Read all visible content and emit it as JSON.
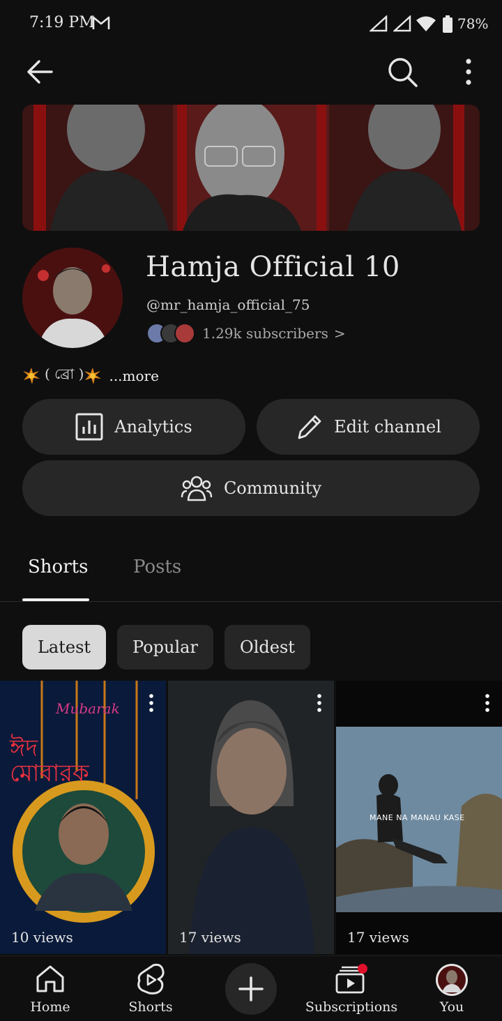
{
  "status_bar": {
    "time": "7:19 PM",
    "battery": "78%"
  },
  "channel": {
    "name": "Hamja Official 10",
    "handle": "@mr_hamja_official_75",
    "subscribers": "1.29k subscribers",
    "subscribers_chevron": ">",
    "description": "( ব্রো )",
    "description_more": "...more"
  },
  "actions": {
    "analytics": "Analytics",
    "edit_channel": "Edit channel",
    "community": "Community"
  },
  "tabs": [
    {
      "label": "Shorts",
      "selected": true
    },
    {
      "label": "Posts",
      "selected": false
    }
  ],
  "chips": [
    {
      "label": "Latest",
      "selected": true
    },
    {
      "label": "Popular",
      "selected": false
    },
    {
      "label": "Oldest",
      "selected": false
    }
  ],
  "shorts": [
    {
      "views": "10 views",
      "overlay_text": "ঈদ মোবারক",
      "overlay_text_2": "Mubarak"
    },
    {
      "views": "17 views"
    },
    {
      "views": "17 views",
      "overlay_text": "MANE NA MANAU KASE"
    }
  ],
  "bottom_nav": [
    {
      "label": "Home",
      "icon": "home-icon"
    },
    {
      "label": "Shorts",
      "icon": "shorts-icon"
    },
    {
      "label": "",
      "icon": "create-icon"
    },
    {
      "label": "Subscriptions",
      "icon": "subscriptions-icon"
    },
    {
      "label": "You",
      "icon": "avatar"
    }
  ],
  "colors": {
    "background": "#0f0f0f",
    "surface": "#272727",
    "notification_dot": "#e0102a"
  }
}
